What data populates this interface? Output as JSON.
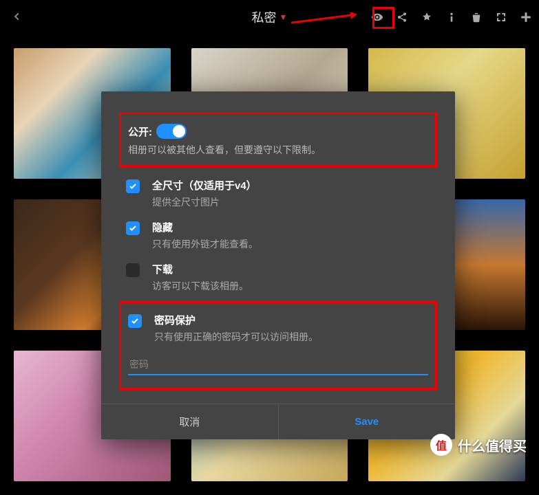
{
  "header": {
    "title": "私密"
  },
  "dialog": {
    "public": {
      "label": "公开:",
      "desc": "相册可以被其他人查看，但要遵守以下限制。",
      "on": true
    },
    "options": {
      "fullsize": {
        "title": "全尺寸（仅适用于v4）",
        "desc": "提供全尺寸图片",
        "checked": true
      },
      "hidden": {
        "title": "隐藏",
        "desc": "只有使用外链才能查看。",
        "checked": true
      },
      "download": {
        "title": "下载",
        "desc": "访客可以下载该相册。",
        "checked": false
      },
      "password": {
        "title": "密码保护",
        "desc": "只有使用正确的密码才可以访问相册。",
        "checked": true,
        "placeholder": "密码",
        "value": ""
      }
    },
    "buttons": {
      "cancel": "取消",
      "save": "Save"
    }
  },
  "watermark": {
    "logo": "值",
    "text": "什么值得买"
  }
}
